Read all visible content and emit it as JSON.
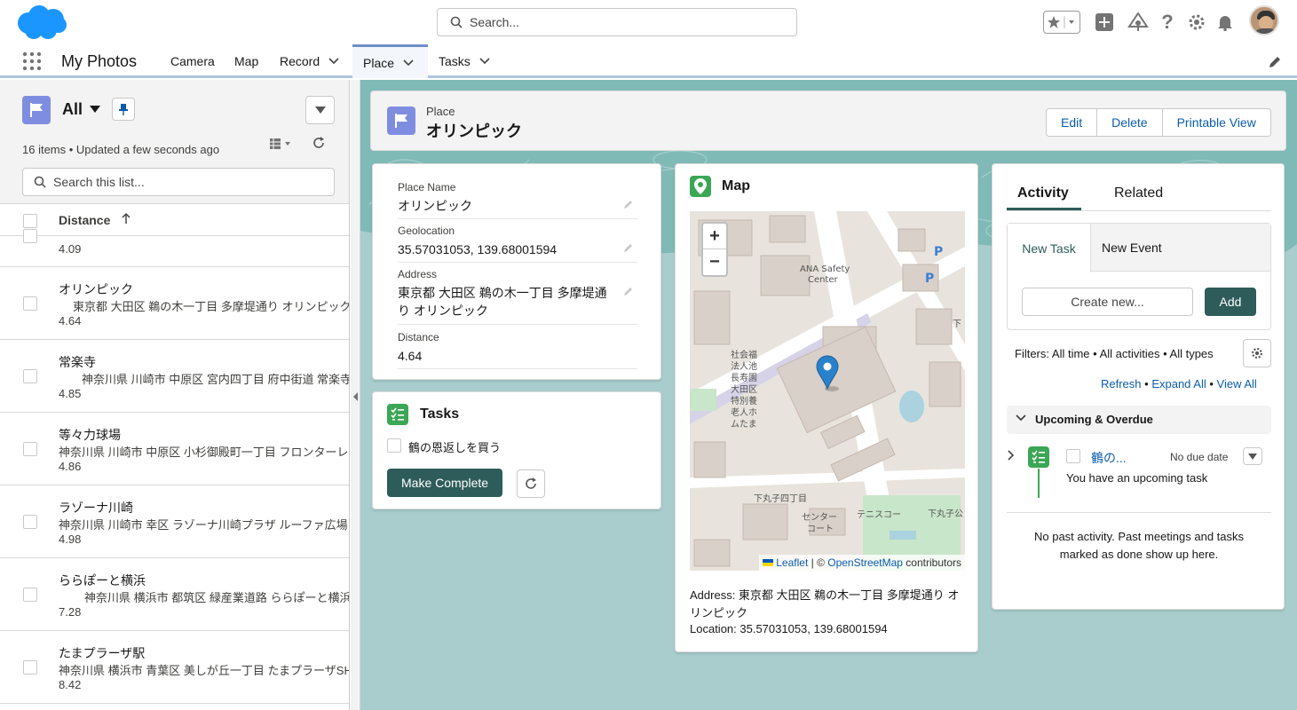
{
  "header": {
    "search_placeholder": "Search...",
    "icons": [
      "favorites-star-icon",
      "add-icon",
      "trailhead-icon",
      "help-icon",
      "setup-gear-icon",
      "notifications-bell-icon",
      "user-avatar"
    ]
  },
  "nav": {
    "app_name": "My Photos",
    "tabs": [
      {
        "label": "Camera"
      },
      {
        "label": "Map"
      },
      {
        "label": "Record"
      },
      {
        "label": "Place"
      },
      {
        "label": "Tasks"
      }
    ],
    "active_tab": "Place"
  },
  "list": {
    "title": "All",
    "meta": "16 items • Updated a few seconds ago",
    "search_placeholder": "Search this list...",
    "column": "Distance",
    "partial_row": {
      "distance": "4.09"
    },
    "rows": [
      {
        "name": "オリンピック",
        "address": "東京都 大田区 鵜の木一丁目 多摩堤通り オリンピック",
        "distance": "4.64"
      },
      {
        "name": "常楽寺",
        "address": "神奈川県 川崎市 中原区 宮内四丁目 府中街道 常楽寺",
        "distance": "4.85"
      },
      {
        "name": "等々力球場",
        "address": "神奈川県 川崎市 中原区 小杉御殿町一丁目 フロンターレロー",
        "distance": "4.86"
      },
      {
        "name": "ラゾーナ川崎",
        "address": "神奈川県 川崎市 幸区 ラゾーナ川崎プラザ ルーファ広場 Pla",
        "distance": "4.98"
      },
      {
        "name": "ららぽーと横浜",
        "address": "神奈川県 横浜市 都筑区 緑産業道路 ららぽーと横浜",
        "distance": "7.28"
      },
      {
        "name": "たまプラーザ駅",
        "address": "神奈川県 横浜市 青葉区 美しが丘一丁目 たまプラーザSHOP",
        "distance": "8.42"
      }
    ]
  },
  "record": {
    "type_label": "Place",
    "title": "オリンピック",
    "buttons": {
      "edit": "Edit",
      "delete": "Delete",
      "printable": "Printable View"
    }
  },
  "details": {
    "fields": [
      {
        "label": "Place Name",
        "value": "オリンピック"
      },
      {
        "label": "Geolocation",
        "value": "35.57031053, 139.68001594"
      },
      {
        "label": "Address",
        "value": "東京都 大田区 鵜の木一丁目 多摩堤通り オリンピック"
      },
      {
        "label": "Distance",
        "value": "4.64"
      }
    ]
  },
  "tasks": {
    "title": "Tasks",
    "items": [
      {
        "label": "鶴の恩返しを買う"
      }
    ],
    "complete_label": "Make Complete"
  },
  "map": {
    "title": "Map",
    "zoom_in": "+",
    "zoom_out": "−",
    "attribution_leaflet": "Leaflet",
    "attribution_sep": " | © ",
    "attribution_osm": "OpenStreetMap",
    "attribution_tail": " contributors",
    "labels": [
      "ANA Safety Center",
      "社会福祉法人池上長寿園大田区立特別養護老人ホームたまがわ",
      "下丸子四丁目",
      "センターコート",
      "テニスコート",
      "下丸子公園",
      "下丸子四丁目"
    ],
    "address_line": "Address: 東京都 大田区 鵜の木一丁目 多摩堤通り オリンピック",
    "location_line": "Location: 35.57031053, 139.68001594"
  },
  "activity": {
    "tabs": {
      "activity": "Activity",
      "related": "Related"
    },
    "subtabs": {
      "new_task": "New Task",
      "new_event": "New Event"
    },
    "create_placeholder": "Create new...",
    "add_label": "Add",
    "filters": "Filters: All time • All activities • All types",
    "links": {
      "refresh": "Refresh",
      "expand": "Expand All",
      "view": "View All",
      "sep": " • "
    },
    "upcoming_label": "Upcoming & Overdue",
    "upcoming_item": {
      "subject": "鶴の...",
      "due": "No due date",
      "desc": "You have an upcoming task"
    },
    "no_past": "No past activity. Past meetings and tasks marked as done show up here."
  },
  "colors": {
    "brand_dark_green": "#2e5c5a",
    "link_blue": "#0b5cab",
    "place_icon": "#7f8de1",
    "task_green": "#3ba755",
    "background_teal": "#a8cdcc"
  }
}
